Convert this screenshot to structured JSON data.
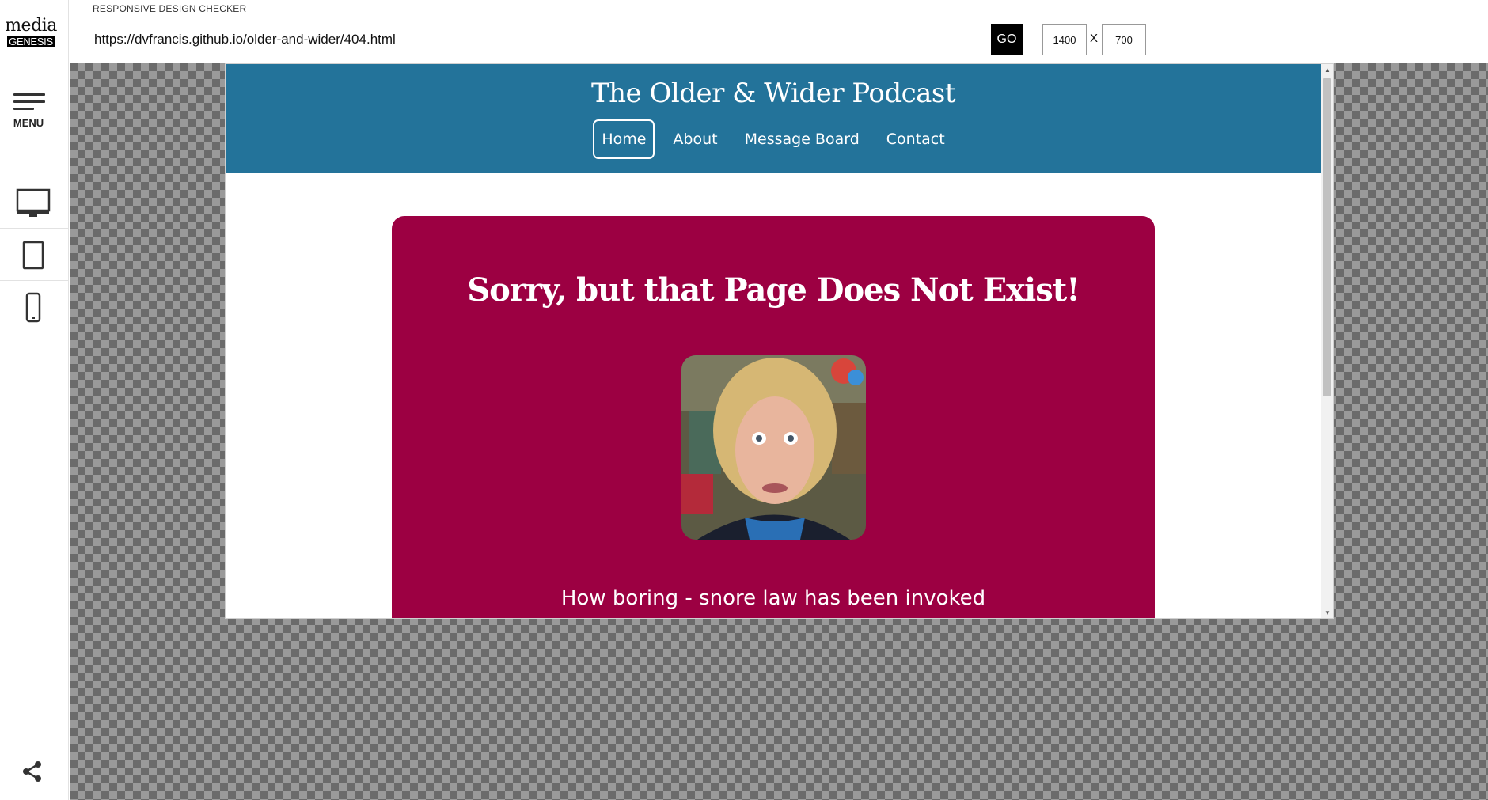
{
  "app": {
    "logo_line1": "media",
    "logo_line2": "GENESIS",
    "title": "RESPONSIVE DESIGN CHECKER",
    "menu_label": "MENU"
  },
  "toolbar": {
    "url": "https://dvfrancis.github.io/older-and-wider/404.html",
    "go_label": "GO",
    "width_value": "1400",
    "height_value": "700",
    "separator": "X"
  },
  "devices": [
    "desktop-icon",
    "tablet-icon",
    "phone-icon"
  ],
  "site": {
    "title": "The Older & Wider Podcast",
    "nav": [
      {
        "label": "Home",
        "active": true
      },
      {
        "label": "About",
        "active": false
      },
      {
        "label": "Message Board",
        "active": false
      },
      {
        "label": "Contact",
        "active": false
      }
    ],
    "heading": "Sorry, but that Page Does Not Exist!",
    "caption": "How boring - snore law has been invoked",
    "colors": {
      "header": "#23739a",
      "card": "#9c0042"
    }
  }
}
